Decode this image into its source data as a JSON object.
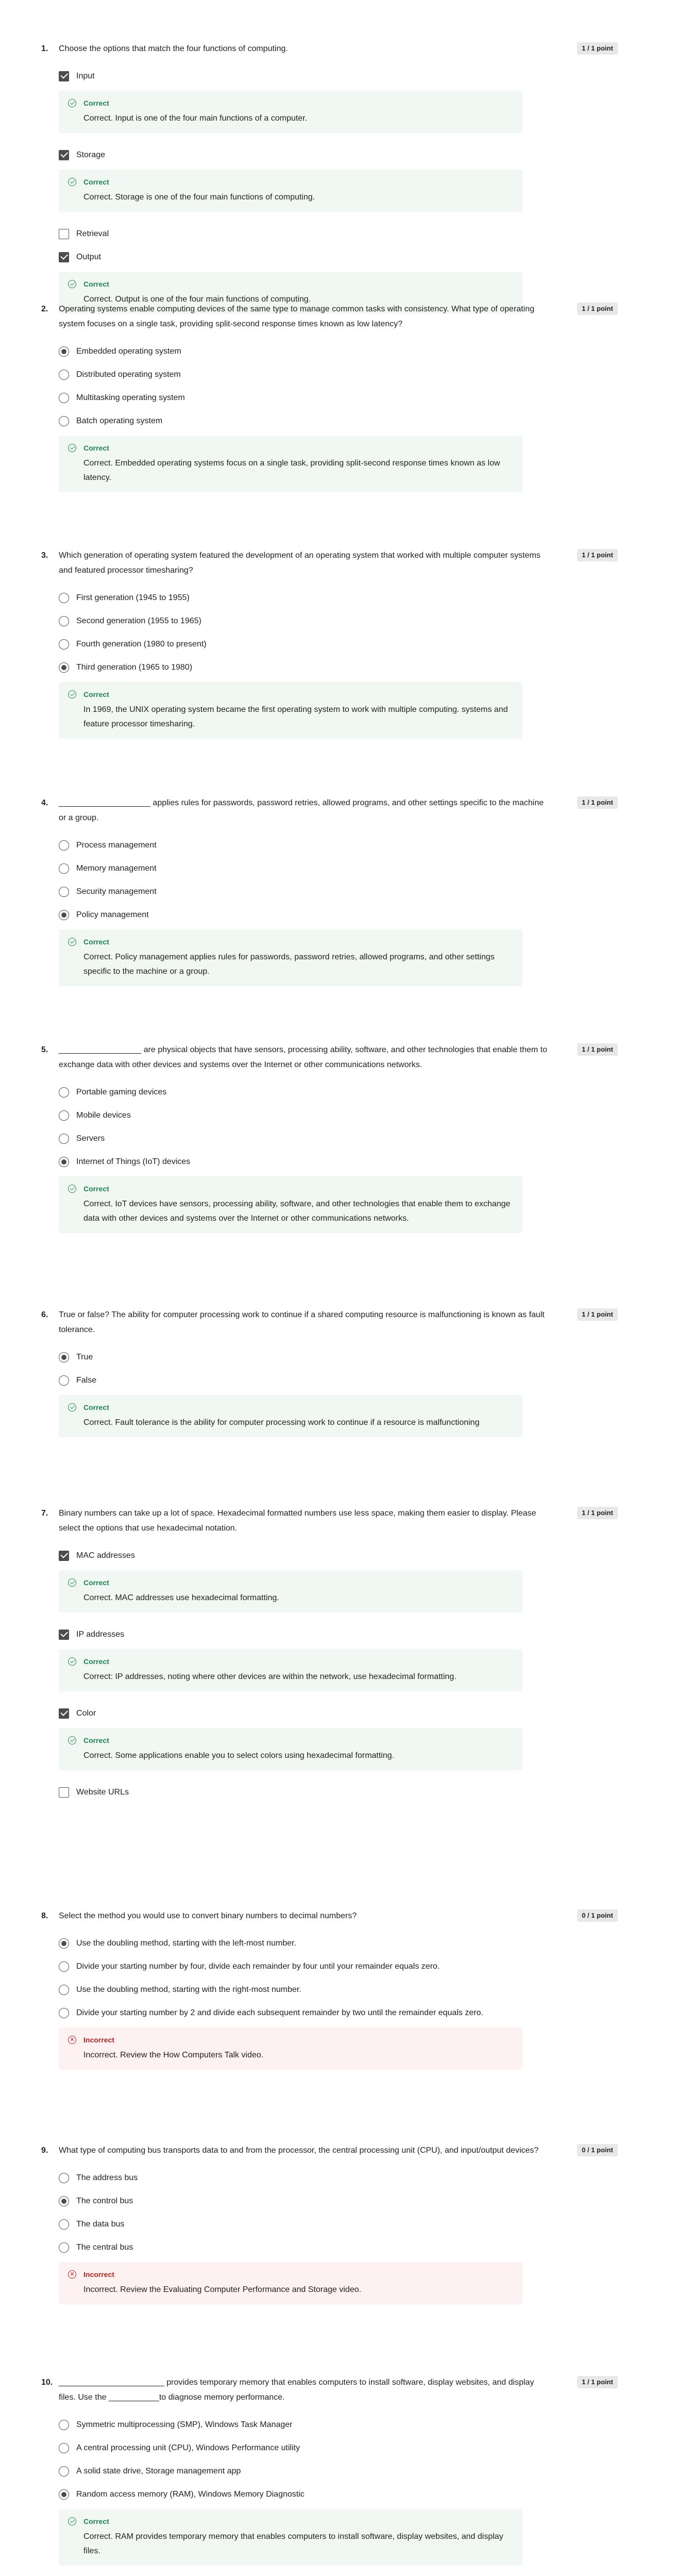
{
  "questions": [
    {
      "number": "1.",
      "text": "Choose the options that match the four functions of computing.",
      "score": "1 / 1 point",
      "type": "checkbox",
      "options": [
        {
          "label": "Input",
          "checked": true,
          "feedback": {
            "status": "correct",
            "title": "Correct",
            "text": "Correct. Input is one of the four main functions of a computer."
          }
        },
        {
          "label": "Storage",
          "checked": true,
          "feedback": {
            "status": "correct",
            "title": "Correct",
            "text": "Correct. Storage is one of the four main functions of computing."
          }
        },
        {
          "label": "Retrieval",
          "checked": false
        },
        {
          "label": "Output",
          "checked": true,
          "feedback": {
            "status": "correct",
            "title": "Correct",
            "text": "Correct. Output is one of the four main functions of computing."
          }
        }
      ]
    },
    {
      "number": "2.",
      "text": "Operating systems enable computing devices of the same type to manage common tasks with consistency. What type of operating system focuses on a single task, providing split-second response times known as low latency?",
      "score": "1 / 1 point",
      "type": "radio",
      "options": [
        {
          "label": "Embedded operating system",
          "checked": true
        },
        {
          "label": "Distributed operating system",
          "checked": false
        },
        {
          "label": "Multitasking operating system",
          "checked": false
        },
        {
          "label": "Batch operating system",
          "checked": false
        }
      ],
      "feedback": {
        "status": "correct",
        "title": "Correct",
        "text": "Correct. Embedded operating systems focus on a single task, providing split-second response times known as low latency."
      }
    },
    {
      "number": "3.",
      "text": "Which generation of operating system featured the development of an operating system that worked with multiple computer systems and featured processor timesharing?",
      "score": "1 / 1 point",
      "type": "radio",
      "options": [
        {
          "label": "First generation (1945 to 1955)",
          "checked": false
        },
        {
          "label": "Second generation (1955 to 1965)",
          "checked": false
        },
        {
          "label": "Fourth generation (1980 to present)",
          "checked": false
        },
        {
          "label": "Third generation (1965 to 1980)",
          "checked": true
        }
      ],
      "feedback": {
        "status": "correct",
        "title": "Correct",
        "text": "In 1969, the UNIX operating system became the first operating system to work with multiple computing. systems and feature processor timesharing."
      }
    },
    {
      "number": "4.",
      "text": "____________________ applies rules for passwords, password retries, allowed programs, and other settings specific to the machine or a group.",
      "score": "1 / 1 point",
      "type": "radio",
      "options": [
        {
          "label": "Process management",
          "checked": false
        },
        {
          "label": "Memory management",
          "checked": false
        },
        {
          "label": "Security management",
          "checked": false
        },
        {
          "label": "Policy management",
          "checked": true
        }
      ],
      "feedback": {
        "status": "correct",
        "title": "Correct",
        "text": "Correct. Policy management applies rules for passwords, password retries, allowed programs, and other settings specific to the machine or a group."
      }
    },
    {
      "number": "5.",
      "text": "__________________ are physical objects that have sensors, processing ability, software, and other technologies that enable them to exchange data with other devices and systems over the Internet or other communications networks.",
      "score": "1 / 1 point",
      "type": "radio",
      "options": [
        {
          "label": "Portable gaming devices",
          "checked": false
        },
        {
          "label": "Mobile devices",
          "checked": false
        },
        {
          "label": "Servers",
          "checked": false
        },
        {
          "label": "Internet of Things (IoT) devices",
          "checked": true
        }
      ],
      "feedback": {
        "status": "correct",
        "title": "Correct",
        "text": "Correct. IoT devices have sensors, processing ability, software, and other technologies that enable them to exchange data with other devices and systems over the Internet or other communications networks."
      }
    },
    {
      "number": "6.",
      "text": "True or false? The ability for computer processing work to continue if a shared computing resource is malfunctioning is known as fault tolerance.",
      "score": "1 / 1 point",
      "type": "radio",
      "options": [
        {
          "label": "True",
          "checked": true
        },
        {
          "label": "False",
          "checked": false
        }
      ],
      "feedback": {
        "status": "correct",
        "title": "Correct",
        "text": "Correct. Fault tolerance is the ability for computer processing work to continue if a resource is malfunctioning"
      }
    },
    {
      "number": "7.",
      "text": "Binary numbers can take up a lot of space. Hexadecimal formatted numbers use less space, making them easier to display. Please select the options that use hexadecimal notation.",
      "score": "1 / 1 point",
      "type": "checkbox",
      "options": [
        {
          "label": "MAC addresses",
          "checked": true,
          "feedback": {
            "status": "correct",
            "title": "Correct",
            "text": "Correct. MAC addresses use hexadecimal formatting."
          }
        },
        {
          "label": "IP addresses",
          "checked": true,
          "feedback": {
            "status": "correct",
            "title": "Correct",
            "text": "Correct: IP addresses, noting where other devices are within the network, use hexadecimal formatting."
          }
        },
        {
          "label": "Color",
          "checked": true,
          "feedback": {
            "status": "correct",
            "title": "Correct",
            "text": "Correct. Some applications enable you to select colors using hexadecimal formatting."
          }
        },
        {
          "label": "Website URLs",
          "checked": false
        }
      ]
    },
    {
      "number": "8.",
      "text": "Select the method you would use to convert binary numbers to decimal numbers?",
      "score": "0 / 1 point",
      "type": "radio",
      "options": [
        {
          "label": " Use the doubling method, starting with the left-most number.",
          "checked": true
        },
        {
          "label": "Divide your starting number by four,  divide each remainder by four  until your remainder equals zero.",
          "checked": false
        },
        {
          "label": "Use the doubling method, starting with the right-most number.",
          "checked": false
        },
        {
          "label": "Divide your starting number by 2 and divide each subsequent remainder by two until the remainder equals zero.",
          "checked": false
        }
      ],
      "feedback": {
        "status": "incorrect",
        "title": "Incorrect",
        "text": "Incorrect. Review the How Computers Talk video."
      }
    },
    {
      "number": "9.",
      "text": "What type of computing bus transports data to and from the processor, the central processing unit (CPU), and input/output devices?",
      "score": "0 / 1 point",
      "type": "radio",
      "options": [
        {
          "label": "The address bus",
          "checked": false
        },
        {
          "label": "The control bus",
          "checked": true
        },
        {
          "label": "The data bus",
          "checked": false
        },
        {
          "label": "The central bus",
          "checked": false
        }
      ],
      "feedback": {
        "status": "incorrect",
        "title": "Incorrect",
        "text": "Incorrect. Review the Evaluating Computer Performance and Storage video."
      }
    },
    {
      "number": "10.",
      "text": "_______________________ provides temporary memory that enables computers to install software, display websites, and display files. Use the ___________to diagnose memory performance.",
      "score": "1 / 1 point",
      "type": "radio",
      "options": [
        {
          "label": "Symmetric multiprocessing (SMP), Windows Task Manager",
          "checked": false
        },
        {
          "label": "A central processing unit (CPU), Windows Performance utility",
          "checked": false
        },
        {
          "label": "A solid state drive, Storage management app",
          "checked": false
        },
        {
          "label": "Random access memory (RAM), Windows Memory Diagnostic",
          "checked": true
        }
      ],
      "feedback": {
        "status": "correct",
        "title": "Correct",
        "text": "Correct. RAM provides temporary memory that enables computers to install software, display websites, and display files."
      }
    }
  ]
}
